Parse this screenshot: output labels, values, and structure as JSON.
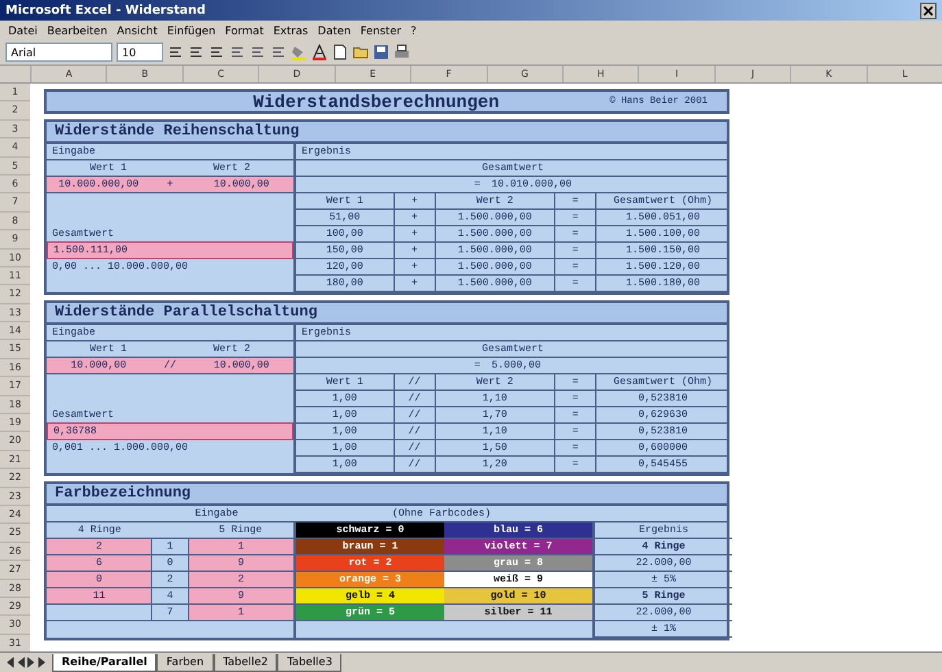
{
  "window": {
    "title": "Microsoft Excel - Widerstand"
  },
  "menu": [
    "Datei",
    "Bearbeiten",
    "Ansicht",
    "Einfügen",
    "Format",
    "Extras",
    "Daten",
    "Fenster",
    "?"
  ],
  "toolbar": {
    "font": "Arial",
    "size": "10"
  },
  "columns": [
    "A",
    "B",
    "C",
    "D",
    "E",
    "F",
    "G",
    "H",
    "I",
    "J",
    "K",
    "L"
  ],
  "rows": [
    "1",
    "2",
    "3",
    "4",
    "5",
    "6",
    "7",
    "8",
    "9",
    "10",
    "11",
    "12",
    "13",
    "14",
    "15",
    "16",
    "17",
    "18",
    "19",
    "20",
    "21",
    "22",
    "23",
    "24",
    "25",
    "26",
    "27",
    "28",
    "29",
    "30",
    "31"
  ],
  "sheet_title": {
    "title": "Widerstandsberechnungen",
    "credit": "© Hans Beier 2001"
  },
  "sections": [
    {
      "title": "Widerstände Reihenschaltung",
      "input_label": "Eingabe",
      "result_label": "Ergebnis",
      "value_labels": [
        "Wert 1",
        "Wert 2"
      ],
      "inputs": [
        "10.000.000,00",
        "+",
        "10.000,00"
      ],
      "total_label": "Gesamtwert",
      "total_value": "1.500.111,00",
      "range": "0,00 ... 10.000.000,00",
      "result_total_label": "Gesamtwert",
      "result_eq": "=",
      "result_total": "10.010.000,00",
      "table": {
        "columns": [
          "Wert 1",
          "+",
          "Wert 2",
          "=",
          "Gesamtwert (Ohm)"
        ],
        "rows": [
          [
            "51,00",
            "+",
            "1.500.000,00",
            "=",
            "1.500.051,00"
          ],
          [
            "100,00",
            "+",
            "1.500.000,00",
            "=",
            "1.500.100,00"
          ],
          [
            "150,00",
            "+",
            "1.500.000,00",
            "=",
            "1.500.150,00"
          ],
          [
            "120,00",
            "+",
            "1.500.000,00",
            "=",
            "1.500.120,00"
          ],
          [
            "180,00",
            "+",
            "1.500.000,00",
            "=",
            "1.500.180,00"
          ]
        ]
      }
    },
    {
      "title": "Widerstände Parallelschaltung",
      "input_label": "Eingabe",
      "result_label": "Ergebnis",
      "value_labels": [
        "Wert 1",
        "Wert 2"
      ],
      "inputs": [
        "10.000,00",
        "//",
        "10.000,00"
      ],
      "total_label": "Gesamtwert",
      "total_value": "0,36788",
      "range": "0,001 ... 1.000.000,00",
      "result_total_label": "Gesamtwert",
      "result_eq": "=",
      "result_total": "5.000,00",
      "table": {
        "columns": [
          "Wert 1",
          "//",
          "Wert 2",
          "=",
          "Gesamtwert (Ohm)"
        ],
        "rows": [
          [
            "1,00",
            "//",
            "1,10",
            "=",
            "0,523810"
          ],
          [
            "1,00",
            "//",
            "1,70",
            "=",
            "0,629630"
          ],
          [
            "1,00",
            "//",
            "1,10",
            "=",
            "0,523810"
          ],
          [
            "1,00",
            "//",
            "1,50",
            "=",
            "0,600000"
          ],
          [
            "1,00",
            "//",
            "1,20",
            "=",
            "0,545455"
          ]
        ]
      }
    }
  ],
  "colors": {
    "title": "Farbbezeichnung",
    "input_label": "Eingabe",
    "note": "(Ohne Farbcodes)",
    "ring_labels": [
      "4 Ringe",
      "5 Ringe"
    ],
    "result_label": "Ergebnis",
    "inputs": [
      {
        "a": "2",
        "idx": "1",
        "b": "1"
      },
      {
        "a": "6",
        "idx": "0",
        "b": "9"
      },
      {
        "a": "0",
        "idx": "2",
        "b": "2"
      },
      {
        "a": "11",
        "idx": "4",
        "b": "9"
      },
      {
        "idx": "7",
        "b": "1"
      }
    ],
    "codes": [
      {
        "label": "schwarz = 0",
        "color": "#000000"
      },
      {
        "label": "blau = 6",
        "color": "#2e3192"
      },
      {
        "label": "braun = 1",
        "color": "#8b3a0f"
      },
      {
        "label": "violett = 7",
        "color": "#92278f"
      },
      {
        "label": "rot = 2",
        "color": "#e8421c"
      },
      {
        "label": "grau = 8",
        "color": "#8c8c8c"
      },
      {
        "label": "orange = 3",
        "color": "#f07f1a"
      },
      {
        "label": "weiß = 9",
        "color": "#ffffff"
      },
      {
        "label": "gelb = 4",
        "color": "#f2e600"
      },
      {
        "label": "gold = 10",
        "color": "#e6c43c"
      },
      {
        "label": "grün = 5",
        "color": "#2e9a48"
      },
      {
        "label": "silber = 11",
        "color": "#c8c8c8"
      }
    ],
    "results": [
      {
        "text": "4 Ringe",
        "kind": "head"
      },
      {
        "text": "22.000,00",
        "kind": "value"
      },
      {
        "text": "± 5%",
        "kind": "value"
      },
      {
        "text": "5 Ringe",
        "kind": "head"
      },
      {
        "text": "22.000,00",
        "kind": "value"
      },
      {
        "text": "± 1%",
        "kind": "value"
      }
    ]
  },
  "sheet_tabs": [
    {
      "label": "Reihe/Parallel",
      "selected": true
    },
    {
      "label": "Farben",
      "selected": false
    },
    {
      "label": "Tabelle2",
      "selected": false
    },
    {
      "label": "Tabelle3",
      "selected": false
    }
  ]
}
